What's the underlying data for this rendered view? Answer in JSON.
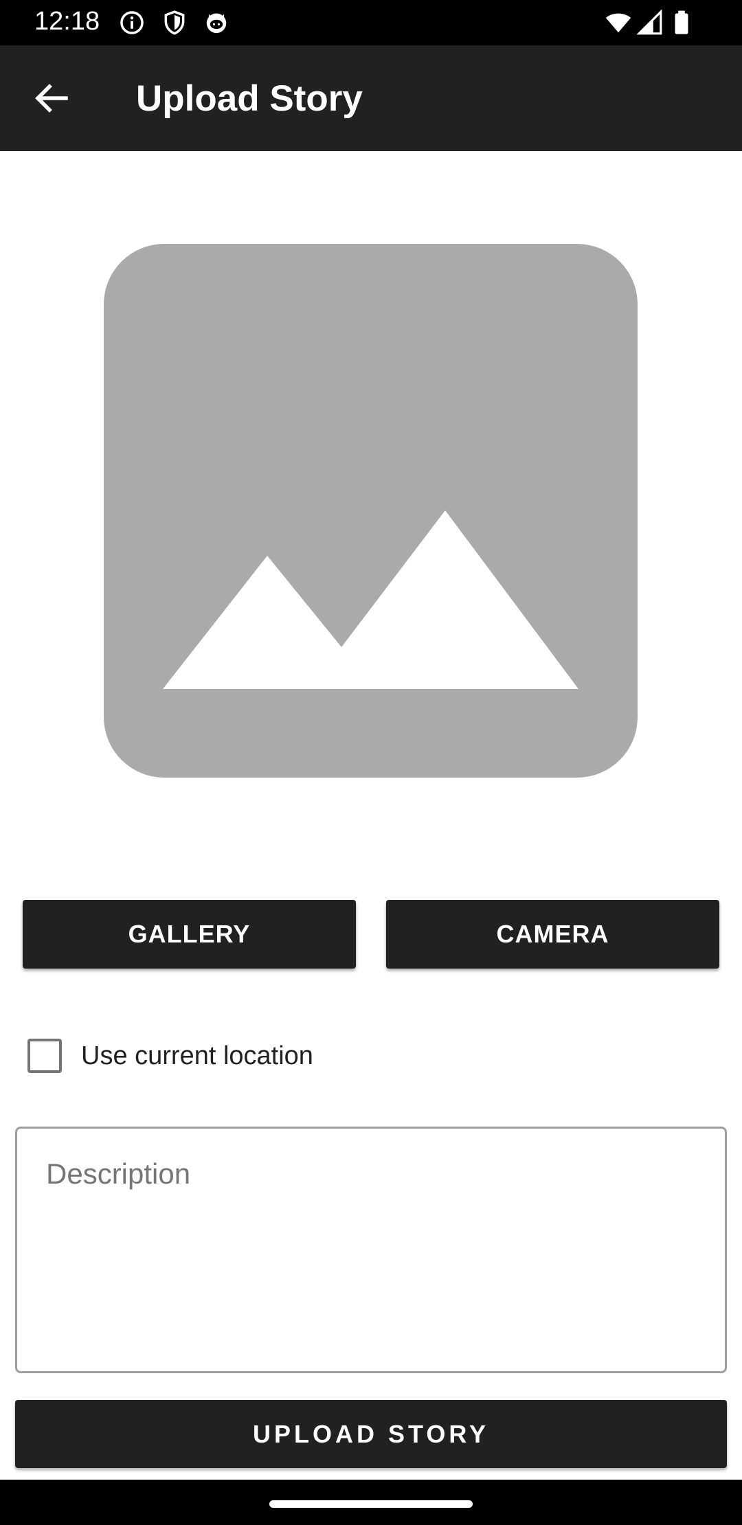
{
  "status_bar": {
    "time": "12:18",
    "left_icons": [
      "info-icon",
      "shield-icon",
      "github-cat-icon"
    ],
    "right_icons": [
      "wifi-icon",
      "signal-icon",
      "battery-icon"
    ]
  },
  "app_bar": {
    "title": "Upload Story",
    "back_icon": "arrow-left-icon",
    "background_color": "#212121"
  },
  "preview": {
    "icon": "image-placeholder-icon",
    "color": "#AAAAAA"
  },
  "buttons": {
    "gallery_label": "GALLERY",
    "camera_label": "CAMERA",
    "upload_label": "UPLOAD STORY"
  },
  "location": {
    "label": "Use current location",
    "checked": false
  },
  "description": {
    "placeholder": "Description",
    "value": ""
  },
  "colors": {
    "primary_dark": "#212121",
    "placeholder_gray": "#AAAAAA"
  }
}
